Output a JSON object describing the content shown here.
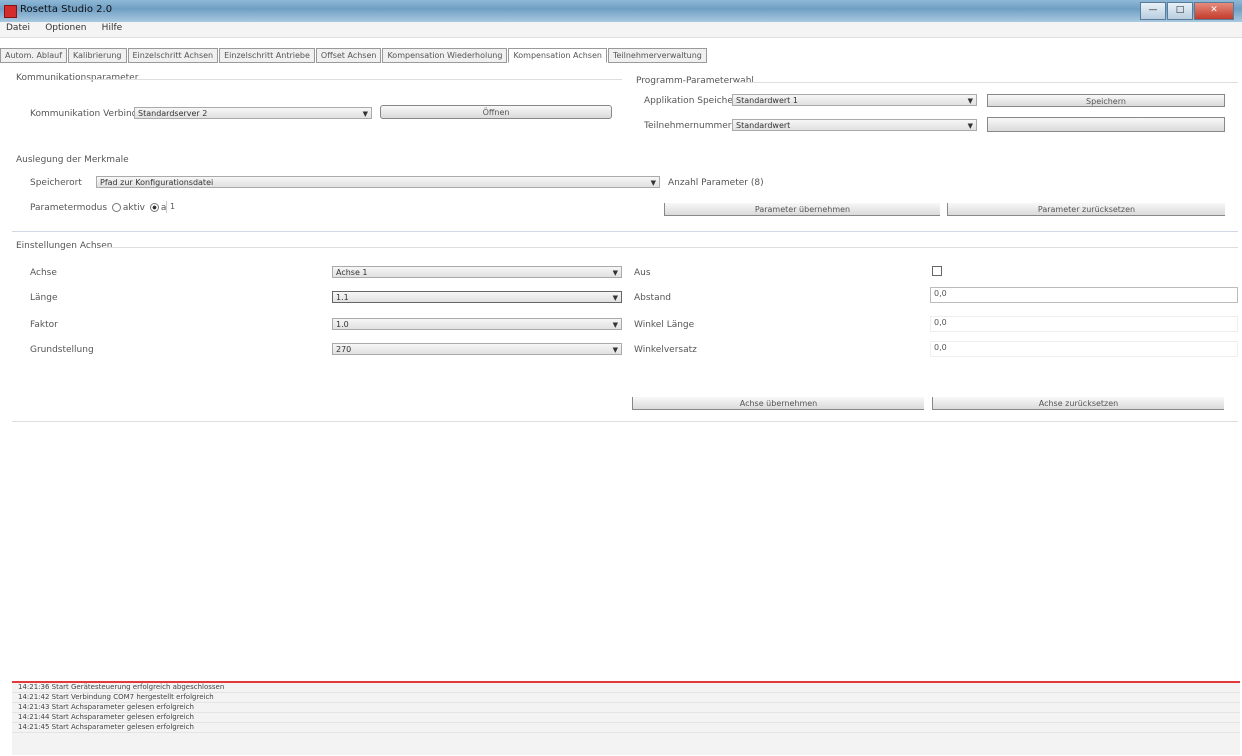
{
  "window": {
    "title": "Rosetta Studio 2.0",
    "min": "—",
    "max": "□",
    "close": "✕"
  },
  "menu": [
    "Datei",
    "Optionen",
    "Hilfe"
  ],
  "tabs": [
    {
      "label": "Autom. Ablauf"
    },
    {
      "label": "Kalibrierung"
    },
    {
      "label": "Einzelschritt Achsen"
    },
    {
      "label": "Einzelschritt Antriebe"
    },
    {
      "label": "Offset Achsen"
    },
    {
      "label": "Kompensation Wiederholung"
    },
    {
      "label": "Kompensation Achsen"
    },
    {
      "label": "Teilnehmerverwaltung"
    }
  ],
  "connection": {
    "group_title": "Kommunikationsparameter",
    "port_label": "Kommunikation Verbindungsmodul",
    "port_value": "Standardserver 2",
    "open_button": "Öffnen"
  },
  "program": {
    "group_title": "Programm-Parameterwahl",
    "row1_label": "Applikation Speicherstelle",
    "row1_value": "Standardwert 1",
    "row1_button": "Speichern",
    "row2_label": "Teilnehmernummer",
    "row2_value": "Standardwert",
    "row2_button": ""
  },
  "feature": {
    "group_title": "Auslegung der Merkmale",
    "file_label": "Speicherort",
    "file_value": "Pfad zur Konfigurationsdatei",
    "extra_label": "Anzahl Parameter (8)",
    "mode_label": "Parametermodus",
    "radio1": "aktiv",
    "radio2": "aus",
    "value_field": "1",
    "btn1": "Parameter übernehmen",
    "btn2": "Parameter zurücksetzen"
  },
  "settings": {
    "group_title": "Einstellungen Achsen",
    "left": [
      {
        "label": "Achse",
        "value": "Achse 1"
      },
      {
        "label": "Länge",
        "value": "1.1"
      },
      {
        "label": "Faktor",
        "value": "1.0"
      },
      {
        "label": "Grundstellung",
        "value": "270"
      }
    ],
    "right": [
      {
        "label": "Aus",
        "value": ""
      },
      {
        "label": "Abstand",
        "value": "0,0"
      },
      {
        "label": "Winkel Länge",
        "value": "0,0"
      },
      {
        "label": "Winkelversatz",
        "value": "0,0"
      }
    ],
    "apply_button": "Achse übernehmen",
    "reset_button": "Achse zurücksetzen"
  },
  "log": [
    "14:21:36 Start Gerätesteuerung erfolgreich abgeschlossen",
    "14:21:42 Start Verbindung COM7 hergestellt erfolgreich",
    "14:21:43 Start Achsparameter gelesen erfolgreich",
    "14:21:44 Start Achsparameter gelesen erfolgreich",
    "14:21:45 Start Achsparameter gelesen erfolgreich"
  ]
}
